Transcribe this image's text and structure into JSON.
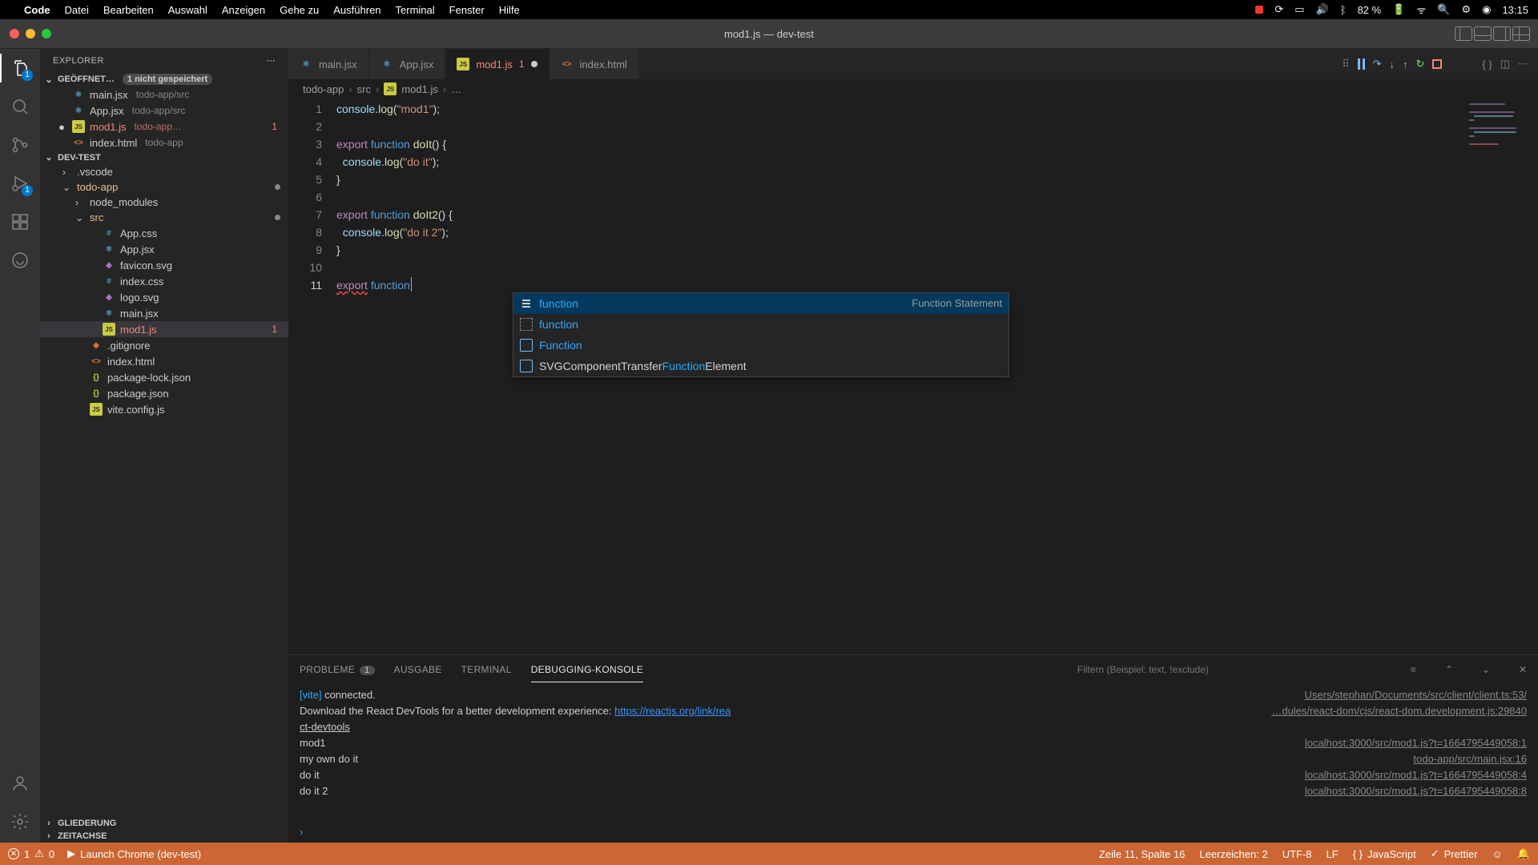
{
  "mac_menu": {
    "app": "Code",
    "items": [
      "Datei",
      "Bearbeiten",
      "Auswahl",
      "Anzeigen",
      "Gehe zu",
      "Ausführen",
      "Terminal",
      "Fenster",
      "Hilfe"
    ],
    "battery": "82 %",
    "clock": "13:15"
  },
  "window_title": "mod1.js — dev-test",
  "activity_badges": {
    "explorer": "1",
    "run": "1"
  },
  "sidebar": {
    "title": "EXPLORER",
    "open_editors_label": "GEÖFFNET…",
    "unsaved_label": "1 nicht gespeichert",
    "open_editors": [
      {
        "name": "main.jsx",
        "hint": "todo-app/src",
        "icon": "jsx"
      },
      {
        "name": "App.jsx",
        "hint": "todo-app/src",
        "icon": "jsx"
      },
      {
        "name": "mod1.js",
        "hint": "todo-app…",
        "icon": "js",
        "error": true,
        "count": "1",
        "modified": true
      },
      {
        "name": "index.html",
        "hint": "todo-app",
        "icon": "html"
      }
    ],
    "workspace": "DEV-TEST",
    "tree": {
      "vscode": ".vscode",
      "todoapp": "todo-app",
      "node_modules": "node_modules",
      "src": "src",
      "files": {
        "appcss": "App.css",
        "appjsx": "App.jsx",
        "favicon": "favicon.svg",
        "indexcss": "index.css",
        "logo": "logo.svg",
        "mainjsx": "main.jsx",
        "mod1": "mod1.js",
        "gitignore": ".gitignore",
        "indexhtml": "index.html",
        "pkglock": "package-lock.json",
        "pkg": "package.json",
        "vite": "vite.config.js"
      },
      "mod1_count": "1"
    },
    "outline": "GLIEDERUNG",
    "timeline": "ZEITACHSE"
  },
  "tabs": [
    {
      "name": "main.jsx",
      "icon": "jsx"
    },
    {
      "name": "App.jsx",
      "icon": "jsx"
    },
    {
      "name": "mod1.js",
      "icon": "js",
      "count": "1",
      "active": true,
      "dirty": true,
      "error": true
    },
    {
      "name": "index.html",
      "icon": "html"
    }
  ],
  "breadcrumbs": [
    "todo-app",
    "src",
    "mod1.js",
    "…"
  ],
  "code": {
    "lines": [
      "1",
      "2",
      "3",
      "4",
      "5",
      "6",
      "7",
      "8",
      "9",
      "10",
      "11"
    ],
    "l1_obj": "console",
    "l1_prop": "log",
    "l1_str": "\"mod1\"",
    "l3_kw1": "export",
    "l3_kw2": "function",
    "l3_fn": "doIt",
    "l4_obj": "console",
    "l4_prop": "log",
    "l4_str": "\"do it\"",
    "l7_fn": "doIt2",
    "l8_str": "\"do it 2\"",
    "l11_kw1": "export",
    "l11_kw2": "function"
  },
  "suggest": {
    "items": [
      {
        "label": "function",
        "kind": "kw",
        "doc": "Function Statement"
      },
      {
        "label": "function",
        "kind": "snip"
      },
      {
        "label": "Function",
        "kind": "var"
      },
      {
        "prefix": "SVGComponentTransfer",
        "match": "Function",
        "suffix": "Element",
        "kind": "var"
      }
    ]
  },
  "panel": {
    "tabs": {
      "problems": "PROBLEME",
      "problems_count": "1",
      "output": "AUSGABE",
      "terminal": "TERMINAL",
      "debug": "DEBUGGING-KONSOLE"
    },
    "filter_placeholder": "Filtern (Beispiel: text, !exclude)",
    "rows": [
      {
        "msg_pre": "[vite] ",
        "msg": "connected.",
        "link": "Users/stephan/Documents/src/client/client.ts:53/"
      },
      {
        "msg": "Download the React DevTools for a better development experience: ",
        "url": "https://reactjs.org/link/rea",
        "link": "…dules/react-dom/cjs/react-dom.development.js:29840"
      },
      {
        "msg": "ct-devtools"
      },
      {
        "msg": "mod1",
        "link": "localhost:3000/src/mod1.js?t=1664795449058:1"
      },
      {
        "msg": "my own do it",
        "link": "todo-app/src/main.jsx:16"
      },
      {
        "msg": "do it",
        "link": "localhost:3000/src/mod1.js?t=1664795449058:4"
      },
      {
        "msg": "do it 2",
        "link": "localhost:3000/src/mod1.js?t=1664795449058:8"
      }
    ],
    "prompt": "›"
  },
  "statusbar": {
    "errors": "1",
    "warnings": "0",
    "launch": "Launch Chrome (dev-test)",
    "pos": "Zeile 11, Spalte 16",
    "bookmarks": "Leerzeichen: 2",
    "encoding": "UTF-8",
    "eol": "LF",
    "lang": "JavaScript",
    "prettier": "Prettier"
  }
}
